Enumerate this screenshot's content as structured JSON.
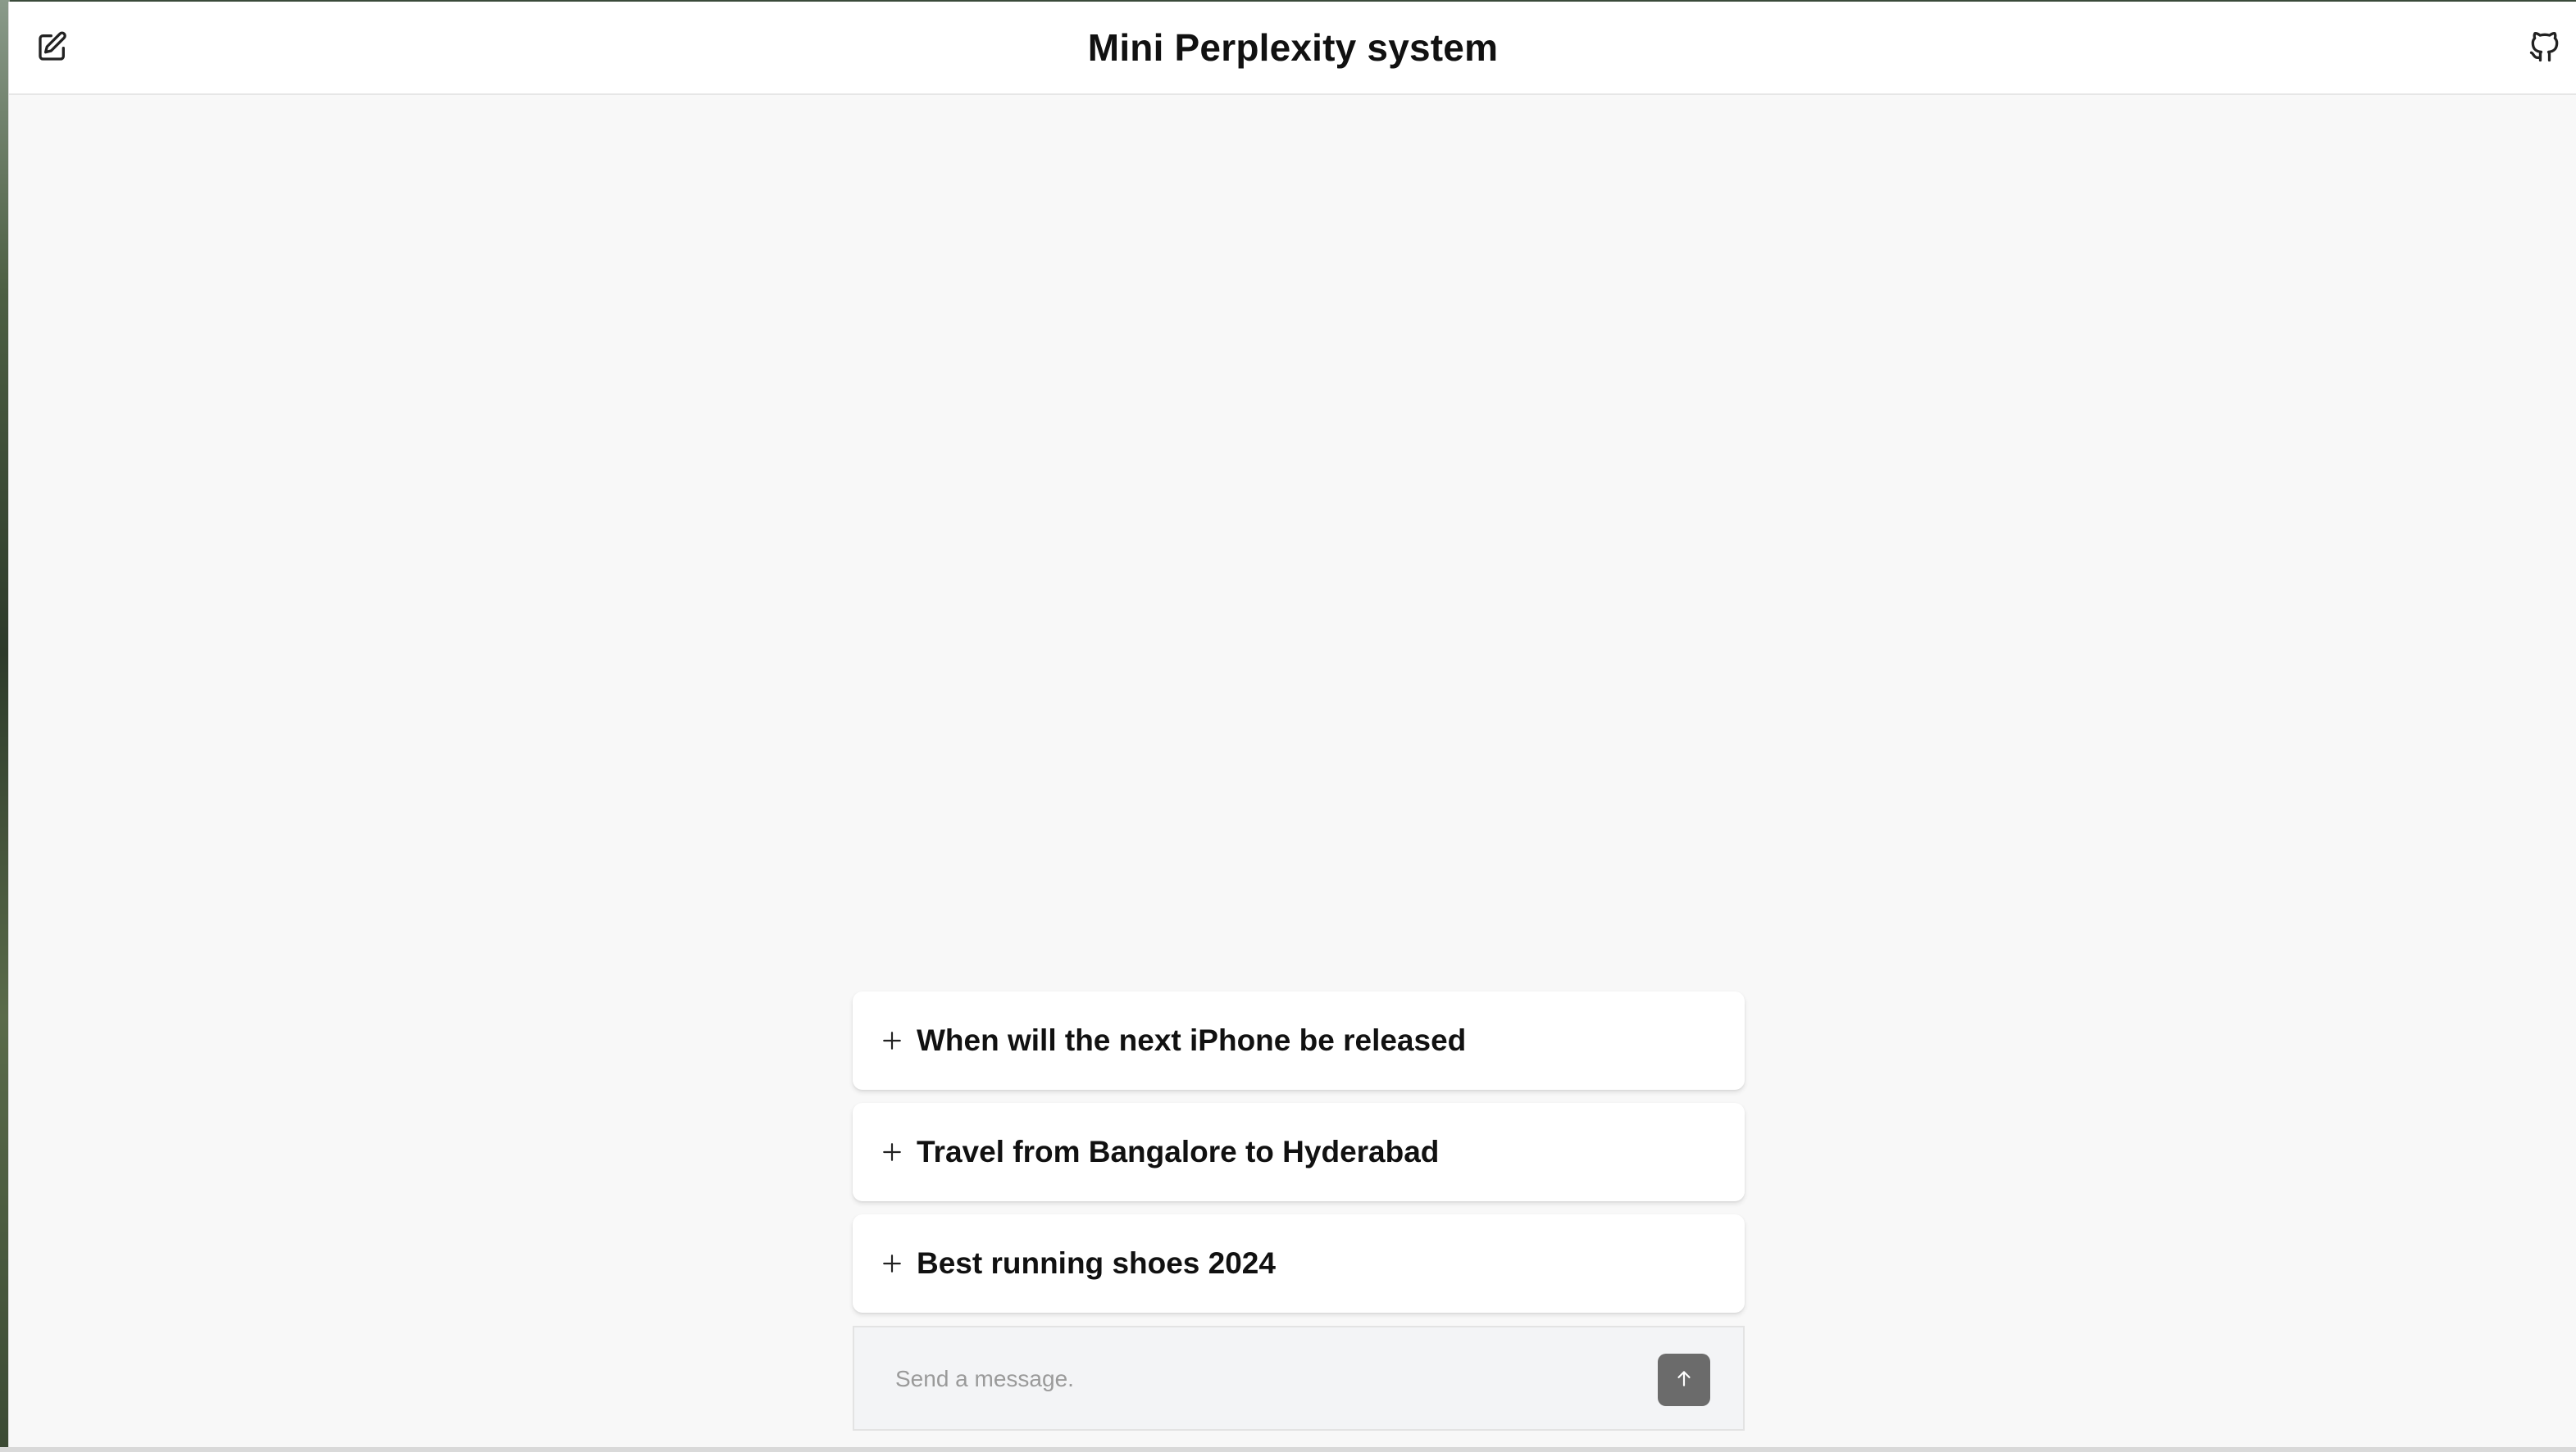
{
  "header": {
    "title": "Mini Perplexity system",
    "new_chat_icon": "edit-square-icon",
    "github_icon": "github-icon"
  },
  "suggestions": [
    {
      "label": "When will the next iPhone be released",
      "icon": "plus-icon"
    },
    {
      "label": "Travel from Bangalore to Hyderabad",
      "icon": "plus-icon"
    },
    {
      "label": "Best running shoes 2024",
      "icon": "plus-icon"
    }
  ],
  "composer": {
    "placeholder": "Send a message.",
    "value": "",
    "send_icon": "arrow-up-icon"
  },
  "colors": {
    "background": "#f8f8f8",
    "header_bg": "#ffffff",
    "card_bg": "#ffffff",
    "send_button": "#6b6b6b",
    "text": "#111111"
  }
}
